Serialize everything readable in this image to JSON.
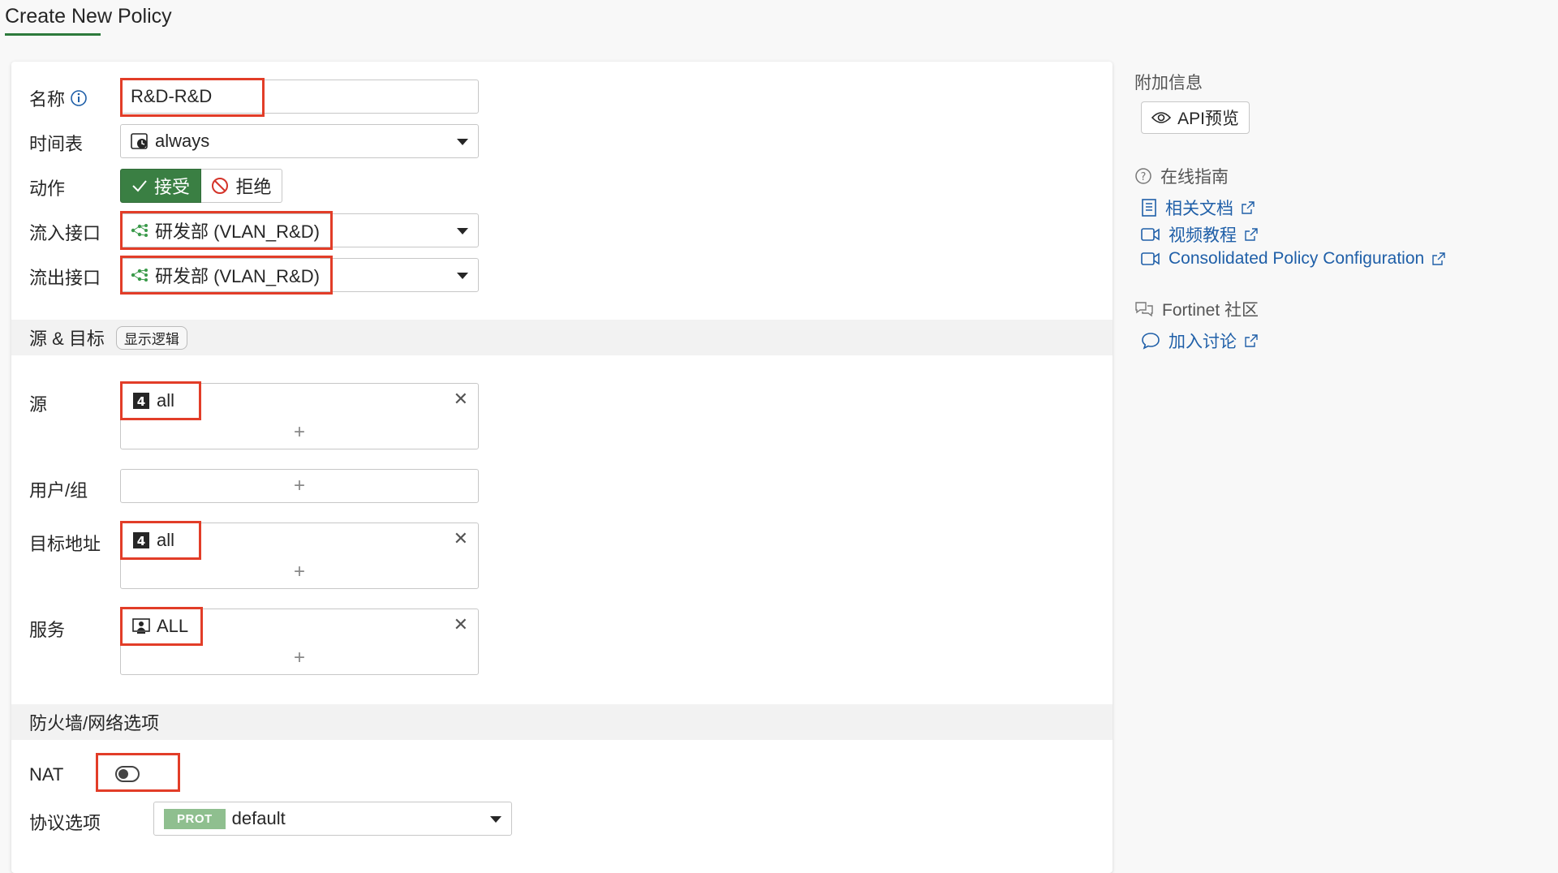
{
  "page": {
    "title": "Create New Policy"
  },
  "form": {
    "name": {
      "label": "名称",
      "value": "R&D-R&D"
    },
    "schedule": {
      "label": "时间表",
      "value": "always"
    },
    "action": {
      "label": "动作",
      "accept": "接受",
      "deny": "拒绝",
      "selected": "accept"
    },
    "incoming": {
      "label": "流入接口",
      "value": "研发部 (VLAN_R&D)"
    },
    "outgoing": {
      "label": "流出接口",
      "value": "研发部 (VLAN_R&D)"
    }
  },
  "section_source_dest": {
    "title": "源 & 目标",
    "logic_button": "显示逻辑"
  },
  "source": {
    "label": "源",
    "value": "all"
  },
  "user_group": {
    "label": "用户/组"
  },
  "destination": {
    "label": "目标地址",
    "value": "all"
  },
  "service": {
    "label": "服务",
    "value": "ALL"
  },
  "section_firewall": {
    "title": "防火墙/网络选项"
  },
  "nat": {
    "label": "NAT",
    "enabled": false
  },
  "protocol_options": {
    "label": "协议选项",
    "badge": "PROT",
    "value": "default"
  },
  "sidebar": {
    "additional_info": "附加信息",
    "api_preview": "API预览",
    "online_guide": "在线指南",
    "links": [
      "相关文档",
      "视频教程",
      "Consolidated Policy Configuration"
    ],
    "community": "Fortinet 社区",
    "join_discussion": "加入讨论"
  },
  "colors": {
    "accent": "#3a7f43",
    "highlight": "#e23d28",
    "link": "#1f5fa8",
    "interface_icon": "#3a9a4a"
  }
}
